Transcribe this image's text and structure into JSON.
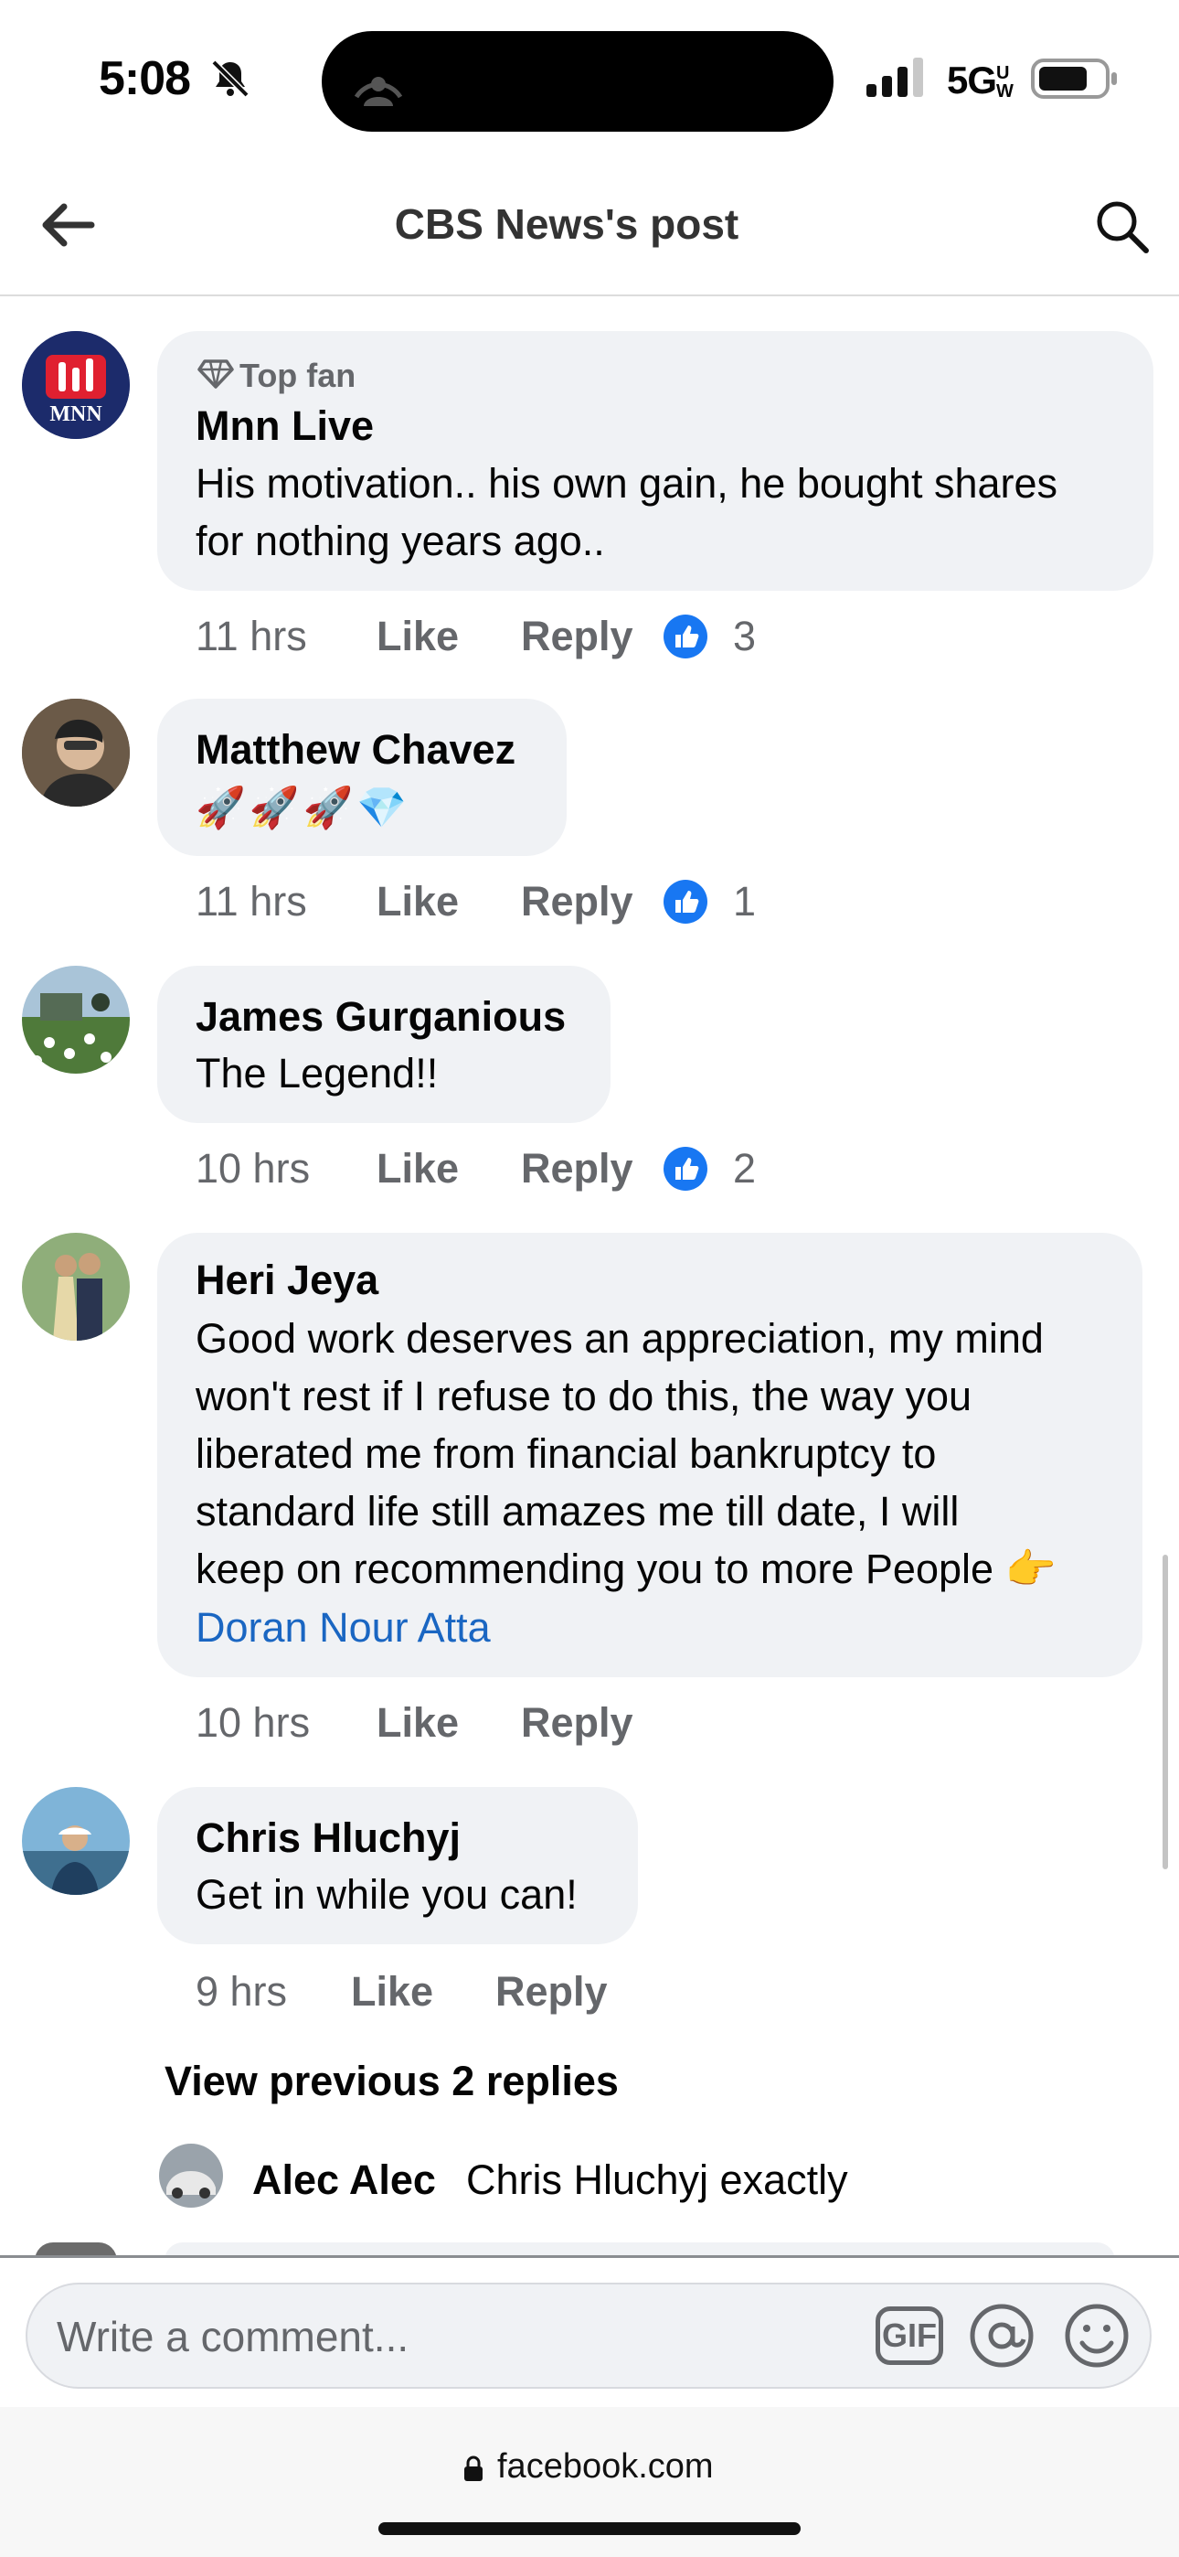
{
  "status_bar": {
    "time": "5:08",
    "network": "5G",
    "network_sup": "UW"
  },
  "header": {
    "title": "CBS News's post"
  },
  "comments": [
    {
      "badge": "Top fan",
      "author": "Mnn Live",
      "lines": [
        "His motivation.. his own gain, he bought shares",
        "for nothing years ago.."
      ],
      "time": "11 hrs",
      "like": "Like",
      "reply": "Reply",
      "reactions": "3",
      "avatar_text": "MNN"
    },
    {
      "author": "Matthew Chavez",
      "emoji": [
        "🚀",
        "🚀",
        "🚀",
        "💎"
      ],
      "time": "11 hrs",
      "like": "Like",
      "reply": "Reply",
      "reactions": "1"
    },
    {
      "author": "James Gurganious",
      "lines": [
        "The Legend!!"
      ],
      "time": "10 hrs",
      "like": "Like",
      "reply": "Reply",
      "reactions": "2"
    },
    {
      "author": "Heri Jeya",
      "lines": [
        "Good work deserves an appreciation, my mind",
        "won't rest if I refuse to do this, the way you",
        "liberated me from financial bankruptcy to",
        "standard life still amazes me till date, I will",
        "keep on recommending you to more People 👉"
      ],
      "mention": "Doran Nour Atta",
      "time": "10 hrs",
      "like": "Like",
      "reply": "Reply"
    },
    {
      "author": "Chris Hluchyj",
      "lines": [
        "Get in while you can!"
      ],
      "time": "9 hrs",
      "like": "Like",
      "reply": "Reply"
    }
  ],
  "replies": {
    "view_previous": "View previous 2 replies",
    "reply_author": "Alec Alec",
    "reply_text": "Chris Hluchyj exactly"
  },
  "composer": {
    "placeholder": "Write a comment...",
    "gif_label": "GIF"
  },
  "browser": {
    "url": "facebook.com"
  },
  "colors": {
    "accent": "#1877f2",
    "bubble": "#f0f2f5",
    "secondary_text": "#65676b",
    "link": "#1a66c2"
  }
}
